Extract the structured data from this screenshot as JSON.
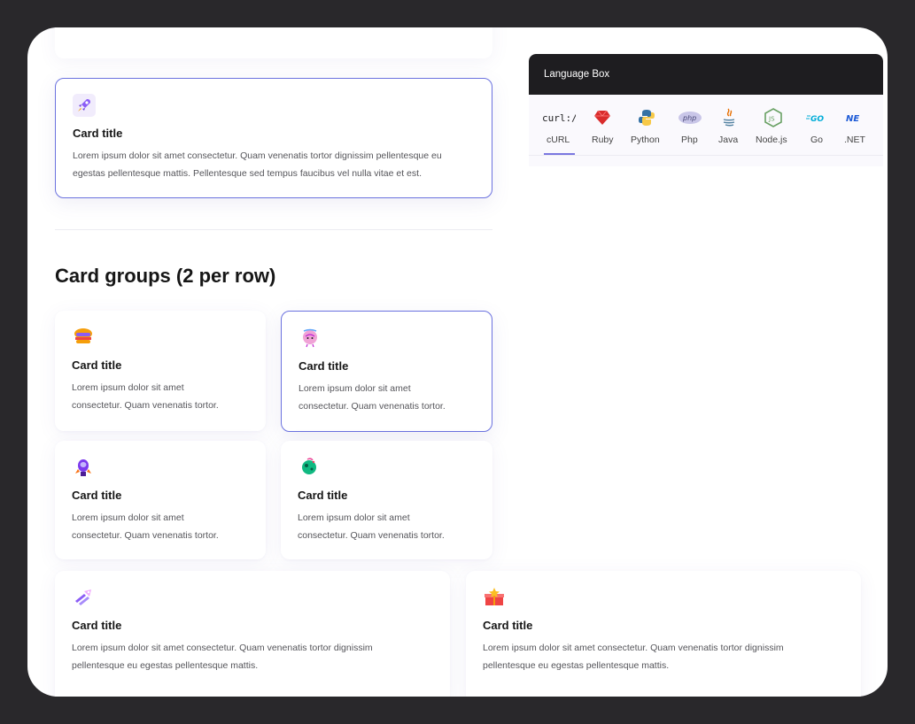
{
  "language_box": {
    "title": "Language Box",
    "tabs": [
      {
        "label": "cURL",
        "icon": "curl-icon",
        "active": true
      },
      {
        "label": "Ruby",
        "icon": "ruby-icon"
      },
      {
        "label": "Python",
        "icon": "python-icon"
      },
      {
        "label": "Php",
        "icon": "php-icon"
      },
      {
        "label": "Java",
        "icon": "java-icon"
      },
      {
        "label": "Node.js",
        "icon": "nodejs-icon"
      },
      {
        "label": "Go",
        "icon": "go-icon"
      },
      {
        "label": ".NET",
        "icon": "dotnet-icon"
      }
    ]
  },
  "top_card": {
    "icon": "rocket-icon",
    "title": "Card title",
    "description_line1": "Lorem ipsum dolor sit amet consectetur. Quam venenatis tortor dignissim pellentesque eu",
    "description_line2": "egestas pellentesque mattis. Pellentesque sed tempus faucibus vel nulla vitae et est."
  },
  "section": {
    "title": "Card groups (2 per row)"
  },
  "grid_cards": [
    {
      "icon": "burger-icon",
      "title": "Card title",
      "line1": "Lorem ipsum dolor sit amet",
      "line2": "consectetur. Quam venenatis tortor."
    },
    {
      "icon": "brain-icon",
      "title": "Card title",
      "line1": "Lorem ipsum dolor sit amet",
      "line2": "consectetur. Quam venenatis tortor."
    },
    {
      "icon": "astronaut-icon",
      "title": "Card title",
      "line1": "Lorem ipsum dolor sit amet",
      "line2": "consectetur. Quam venenatis tortor."
    },
    {
      "icon": "planet-icon",
      "title": "Card title",
      "line1": "Lorem ipsum dolor sit amet",
      "line2": "consectetur. Quam venenatis tortor."
    }
  ],
  "wide_cards": [
    {
      "icon": "rockets-icon",
      "title": "Card title",
      "line1": "Lorem ipsum dolor sit amet consectetur. Quam venenatis tortor dignissim",
      "line2": "pellentesque eu egestas pellentesque mattis."
    },
    {
      "icon": "gift-box-icon",
      "title": "Card title",
      "line1": "Lorem ipsum dolor sit amet consectetur. Quam venenatis tortor dignissim",
      "line2": "pellentesque eu egestas pellentesque mattis."
    }
  ],
  "colors": {
    "accent": "#6b72df",
    "frame_bg": "#ffffff",
    "outer_bg": "#29282b",
    "header_bg": "#1e1d20"
  }
}
